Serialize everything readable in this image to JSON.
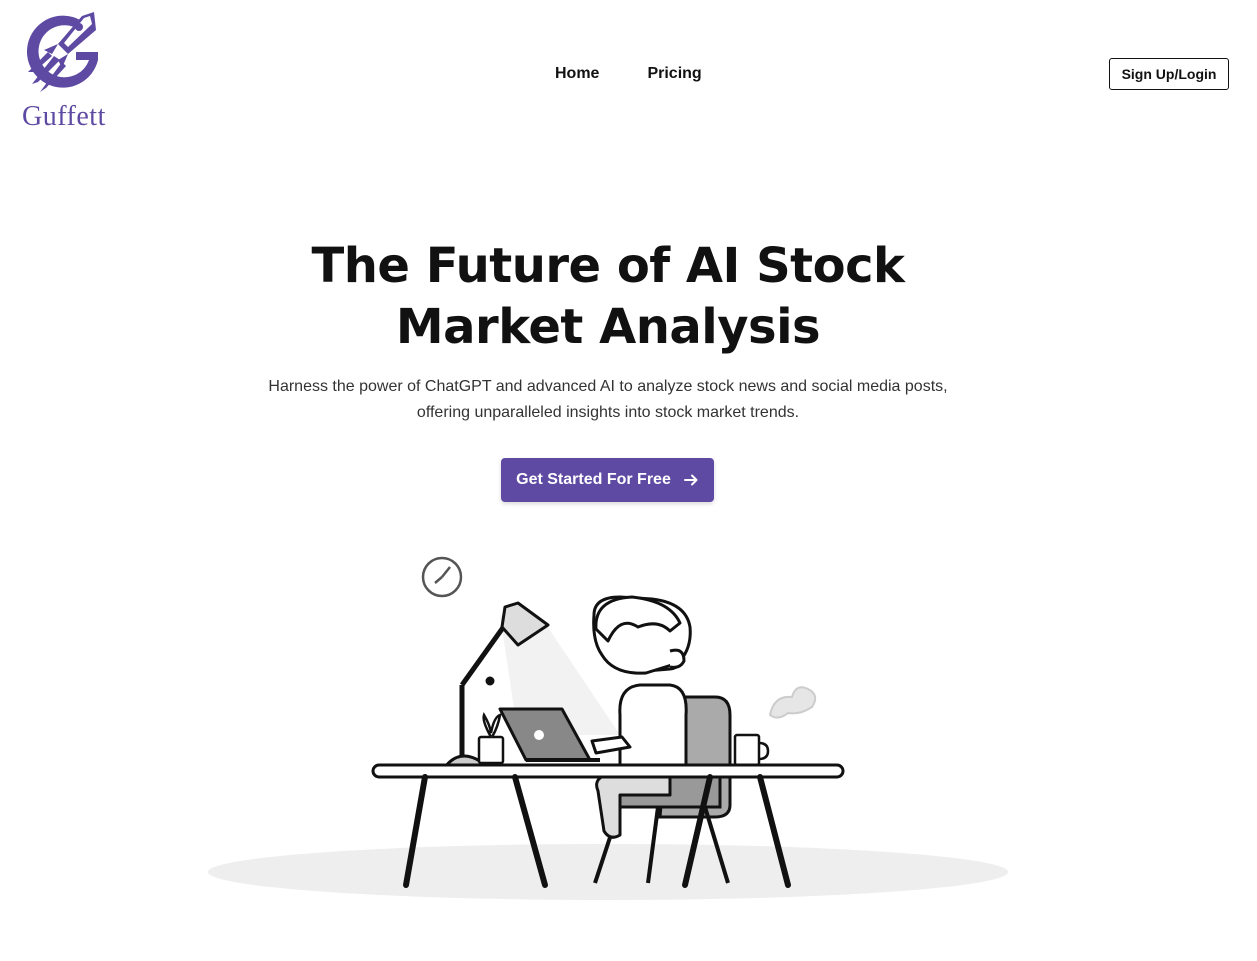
{
  "brand": {
    "name": "Guffett",
    "accent": "#5e4aa3"
  },
  "nav": {
    "items": [
      {
        "label": "Home"
      },
      {
        "label": "Pricing"
      }
    ]
  },
  "header": {
    "signup_label": "Sign Up/Login"
  },
  "hero": {
    "title": "The Future of AI Stock Market Analysis",
    "subtitle": "Harness the power of ChatGPT and advanced AI to analyze stock news and social media posts, offering unparalleled insights into stock market trends.",
    "cta_label": "Get Started For Free",
    "cta_icon": "arrow-right-icon"
  },
  "illustration": {
    "name": "person-working-at-desk-illustration"
  }
}
